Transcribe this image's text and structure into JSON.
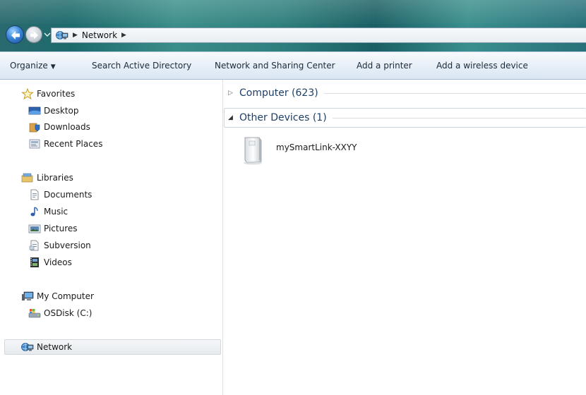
{
  "address_bar": {
    "crumbs": [
      "Network"
    ]
  },
  "toolbar": {
    "items": [
      "Organize",
      "Search Active Directory",
      "Network and Sharing Center",
      "Add a printer",
      "Add a wireless device"
    ]
  },
  "nav": {
    "favorites": {
      "label": "Favorites",
      "items": [
        "Desktop",
        "Downloads",
        "Recent Places"
      ]
    },
    "libraries": {
      "label": "Libraries",
      "items": [
        "Documents",
        "Music",
        "Pictures",
        "Subversion",
        "Videos"
      ]
    },
    "computer": {
      "label": "My Computer",
      "items": [
        "OSDisk (C:)"
      ]
    },
    "network": {
      "label": "Network"
    }
  },
  "content": {
    "groups": [
      {
        "label": "Computer (623)",
        "expanded": false
      },
      {
        "label": "Other Devices (1)",
        "expanded": true
      }
    ],
    "device": {
      "label": "mySmartLink-XXYY",
      "icon": "network-device-icon"
    }
  },
  "colors": {
    "accent": "#1e3f66",
    "titlebar": "#2f7f7e",
    "toolbar": "#e6eef7"
  }
}
